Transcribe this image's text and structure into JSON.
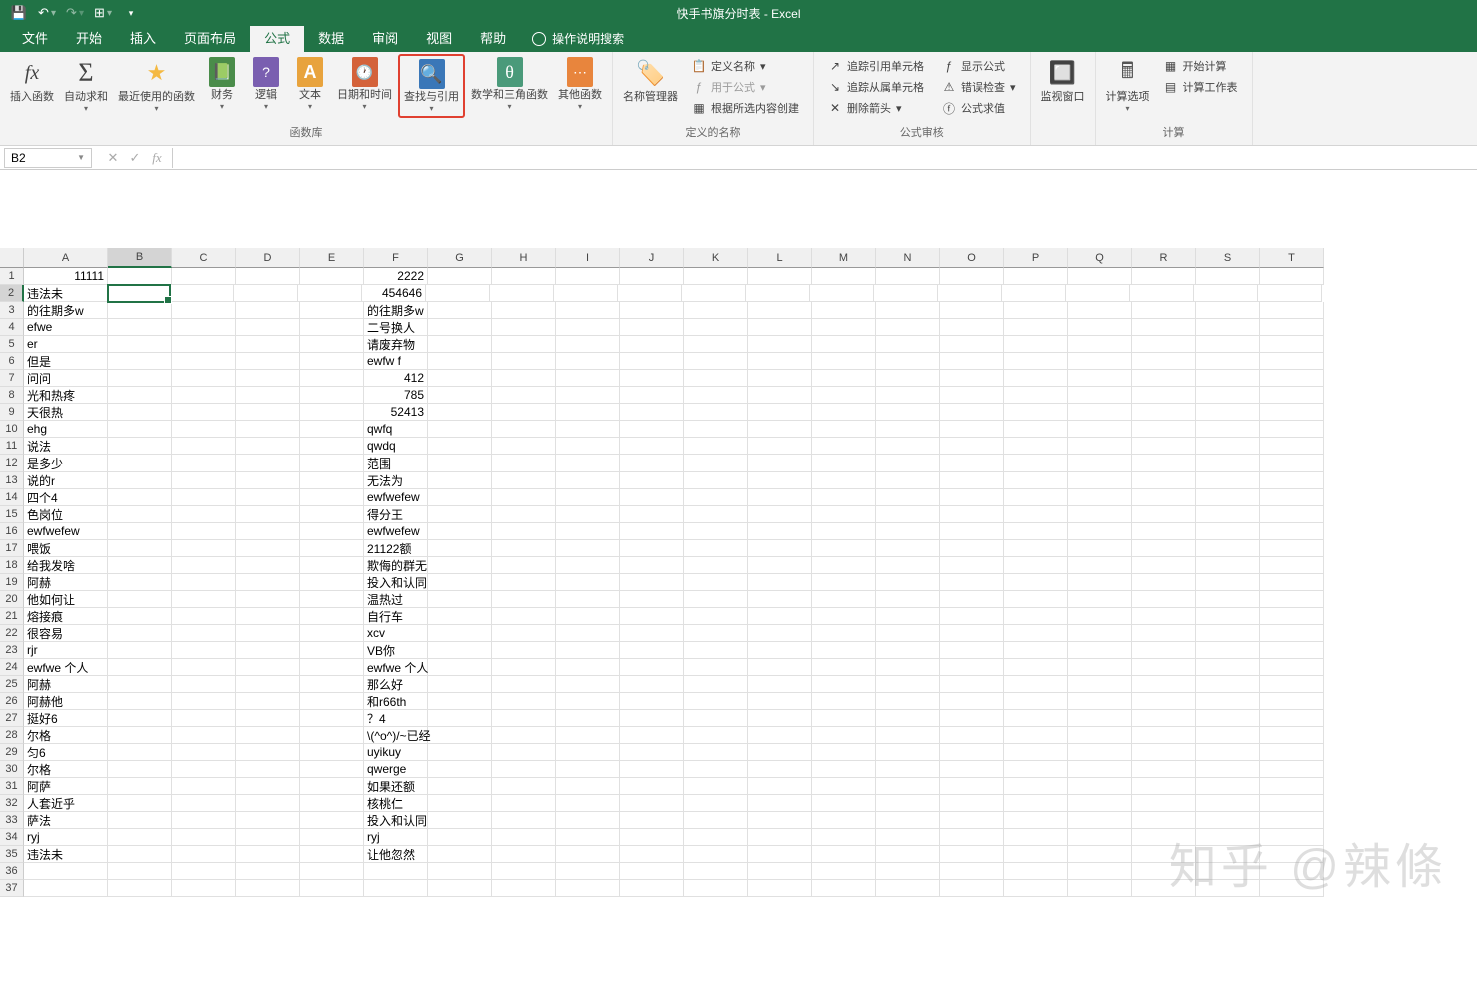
{
  "title": "快手书旗分时表 - Excel",
  "qat": {
    "save": "💾",
    "undo": "↶",
    "redo": "↷",
    "touch": "⊞"
  },
  "tabs": [
    "文件",
    "开始",
    "插入",
    "页面布局",
    "公式",
    "数据",
    "审阅",
    "视图",
    "帮助"
  ],
  "active_tab": "公式",
  "tell_me": "操作说明搜索",
  "ribbon": {
    "insert_fn": "插入函数",
    "autosum": "自动求和",
    "recent": "最近使用的函数",
    "financial": "财务",
    "logical": "逻辑",
    "text": "文本",
    "datetime": "日期和时间",
    "lookup": "查找与引用",
    "math": "数学和三角函数",
    "more": "其他函数",
    "grp_lib": "函数库",
    "name_mgr": "名称管理器",
    "def_name": "定义名称",
    "use_formula": "用于公式",
    "create_sel": "根据所选内容创建",
    "grp_names": "定义的名称",
    "trace_prec": "追踪引用单元格",
    "trace_dep": "追踪从属单元格",
    "remove_arrows": "删除箭头",
    "show_formulas": "显示公式",
    "error_check": "错误检查",
    "eval_formula": "公式求值",
    "grp_audit": "公式审核",
    "watch": "监视窗口",
    "calc_opts": "计算选项",
    "calc_now": "开始计算",
    "calc_sheet": "计算工作表",
    "grp_calc": "计算"
  },
  "namebox": "B2",
  "columns": [
    "A",
    "B",
    "C",
    "D",
    "E",
    "F",
    "G",
    "H",
    "I",
    "J",
    "K",
    "L",
    "M",
    "N",
    "O",
    "P",
    "Q",
    "R",
    "S",
    "T"
  ],
  "rows": 37,
  "selected": {
    "row": 2,
    "col": "B"
  },
  "data": {
    "A": [
      "11111",
      "违法未",
      "的往期多w",
      "efwe",
      "er",
      "但是",
      "问问",
      "光和热疼",
      "天很热",
      "ehg",
      "说法",
      "是多少",
      "说的r",
      "四个4",
      "色岗位",
      "ewfwefew",
      "喂饭",
      "给我发啥",
      "阿赫",
      "他如何让",
      "熔接痕",
      "很容易",
      "rjr",
      "ewfwe 个人",
      "阿赫",
      "阿赫他",
      "挺好6",
      "尔格",
      "匀6",
      "尔格",
      "阿萨",
      "人套近乎",
      "萨法",
      "ryj",
      "违法未",
      "",
      ""
    ],
    "F": [
      "2222",
      "454646",
      "的往期多w",
      "二号换人",
      "请废弃物",
      "ewfw f",
      "412",
      "785",
      "52413",
      "qwfq",
      "qwdq",
      "范围",
      "无法为",
      "ewfwefew",
      "得分王",
      "ewfwefew",
      "21122额",
      "欺侮的群无",
      "投入和认同",
      "温热过",
      "自行车",
      "xcv",
      "VB你",
      "ewfwe 个人",
      "那么好",
      "和r66th",
      "？4",
      "\\(^o^)/~已经",
      "uyikuy",
      "qwerge",
      "如果还额",
      "核桃仁",
      "投入和认同",
      "ryj",
      "让他忽然",
      "",
      ""
    ]
  },
  "numeric_cells": {
    "A": [
      1
    ],
    "F": [
      1,
      2,
      7,
      8,
      9
    ]
  },
  "watermark": "知乎 @辣條"
}
